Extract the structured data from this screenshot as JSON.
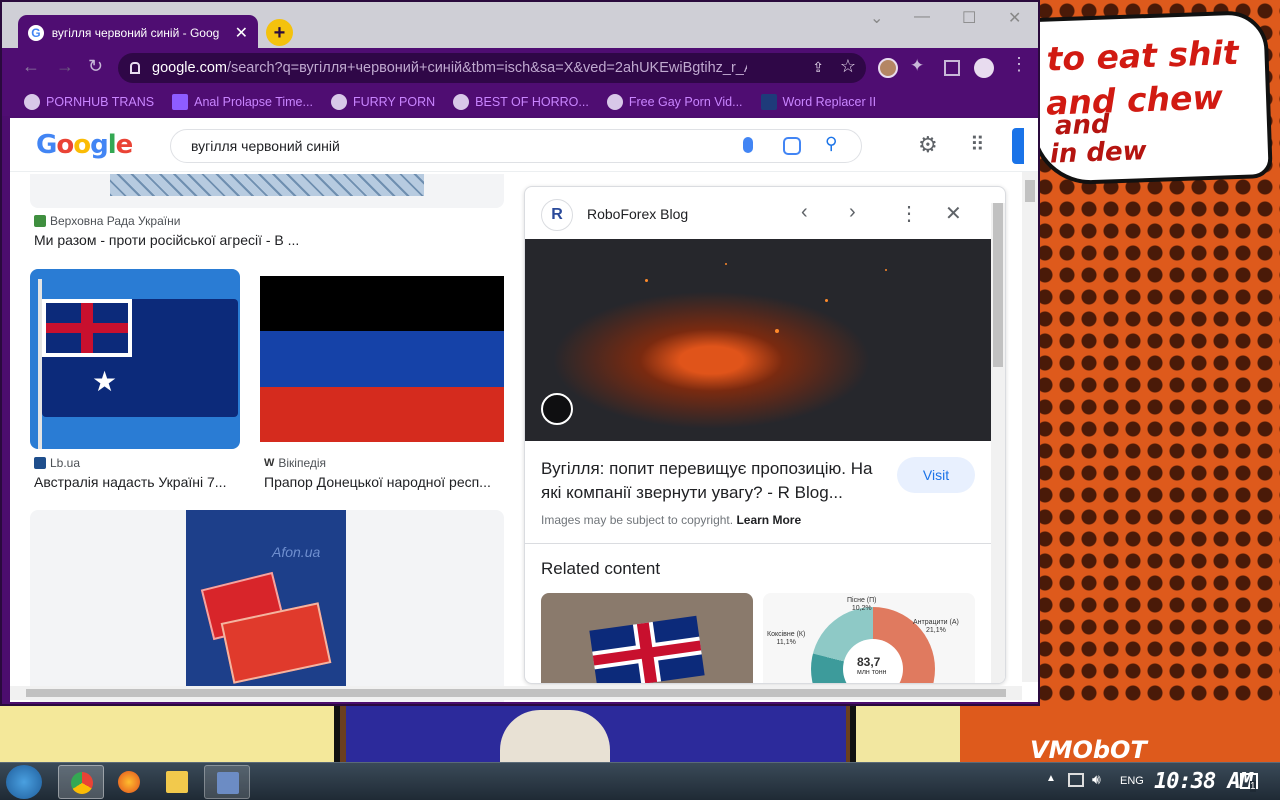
{
  "wallpaper": {
    "bubble_lines": [
      "to eat shit",
      "and chew",
      "and",
      "in dew"
    ],
    "sign_text": "VMObOT"
  },
  "browser": {
    "tab": {
      "title": "вугілля червоний синій - Goog",
      "close": "✕"
    },
    "new_tab": "+",
    "window_controls": {
      "tab_search": "⌄",
      "minimize": "—",
      "maximize": "☐",
      "close": "✕"
    },
    "nav": {
      "back": "←",
      "forward": "→",
      "reload": "↻"
    },
    "url": {
      "host": "google.com",
      "path": "/search?q=вугілля+червоний+синій&tbm=isch&sa=X&ved=2ahUKEwiBgtihz_r_AhW3q..."
    },
    "bookmarks": [
      {
        "label": "PORNHUB TRANS",
        "icon": "globe-icon"
      },
      {
        "label": "Anal Prolapse Time...",
        "icon": "bookmark-site-icon"
      },
      {
        "label": "FURRY PORN",
        "icon": "lambda-icon"
      },
      {
        "label": "BEST OF HORRO...",
        "icon": "globe-icon"
      },
      {
        "label": "Free Gay Porn Vid...",
        "icon": "site-icon"
      },
      {
        "label": "Word Replacer II",
        "icon": "word-replacer-icon"
      }
    ]
  },
  "google": {
    "search_query": "вугілля червоний синій",
    "results": [
      {
        "source": "Верховна Рада України",
        "caption": "Ми разом - проти російської агресії - В ..."
      },
      {
        "source": "Lb.ua",
        "caption": "Австралія надасть Україні 7..."
      },
      {
        "source": "Вікіпедія",
        "caption": "Прапор Донецької народної респ..."
      }
    ],
    "thumb_watermark": "Afon.ua",
    "flag_colors": [
      "#000000",
      "#1542a8",
      "#d52b1e"
    ]
  },
  "preview": {
    "site_name": "RoboForex Blog",
    "site_initial": "R",
    "title": "Вугілля: попит перевищує пропозицію. На які компанії звернути увагу? - R Blog...",
    "visit_label": "Visit",
    "copyright_note": "Images may be subject to copyright.",
    "learn_more": "Learn More",
    "related_heading": "Related content",
    "related_chart": {
      "value": "83,7",
      "unit": "млн тонн",
      "labels": [
        "Пісне (П)\n10,2%",
        "Коксівне (К)\n11,1%",
        "Антрацити (А)\n21,1%"
      ]
    }
  },
  "taskbar": {
    "lang": "ENG",
    "clock": "10:38 AM"
  }
}
